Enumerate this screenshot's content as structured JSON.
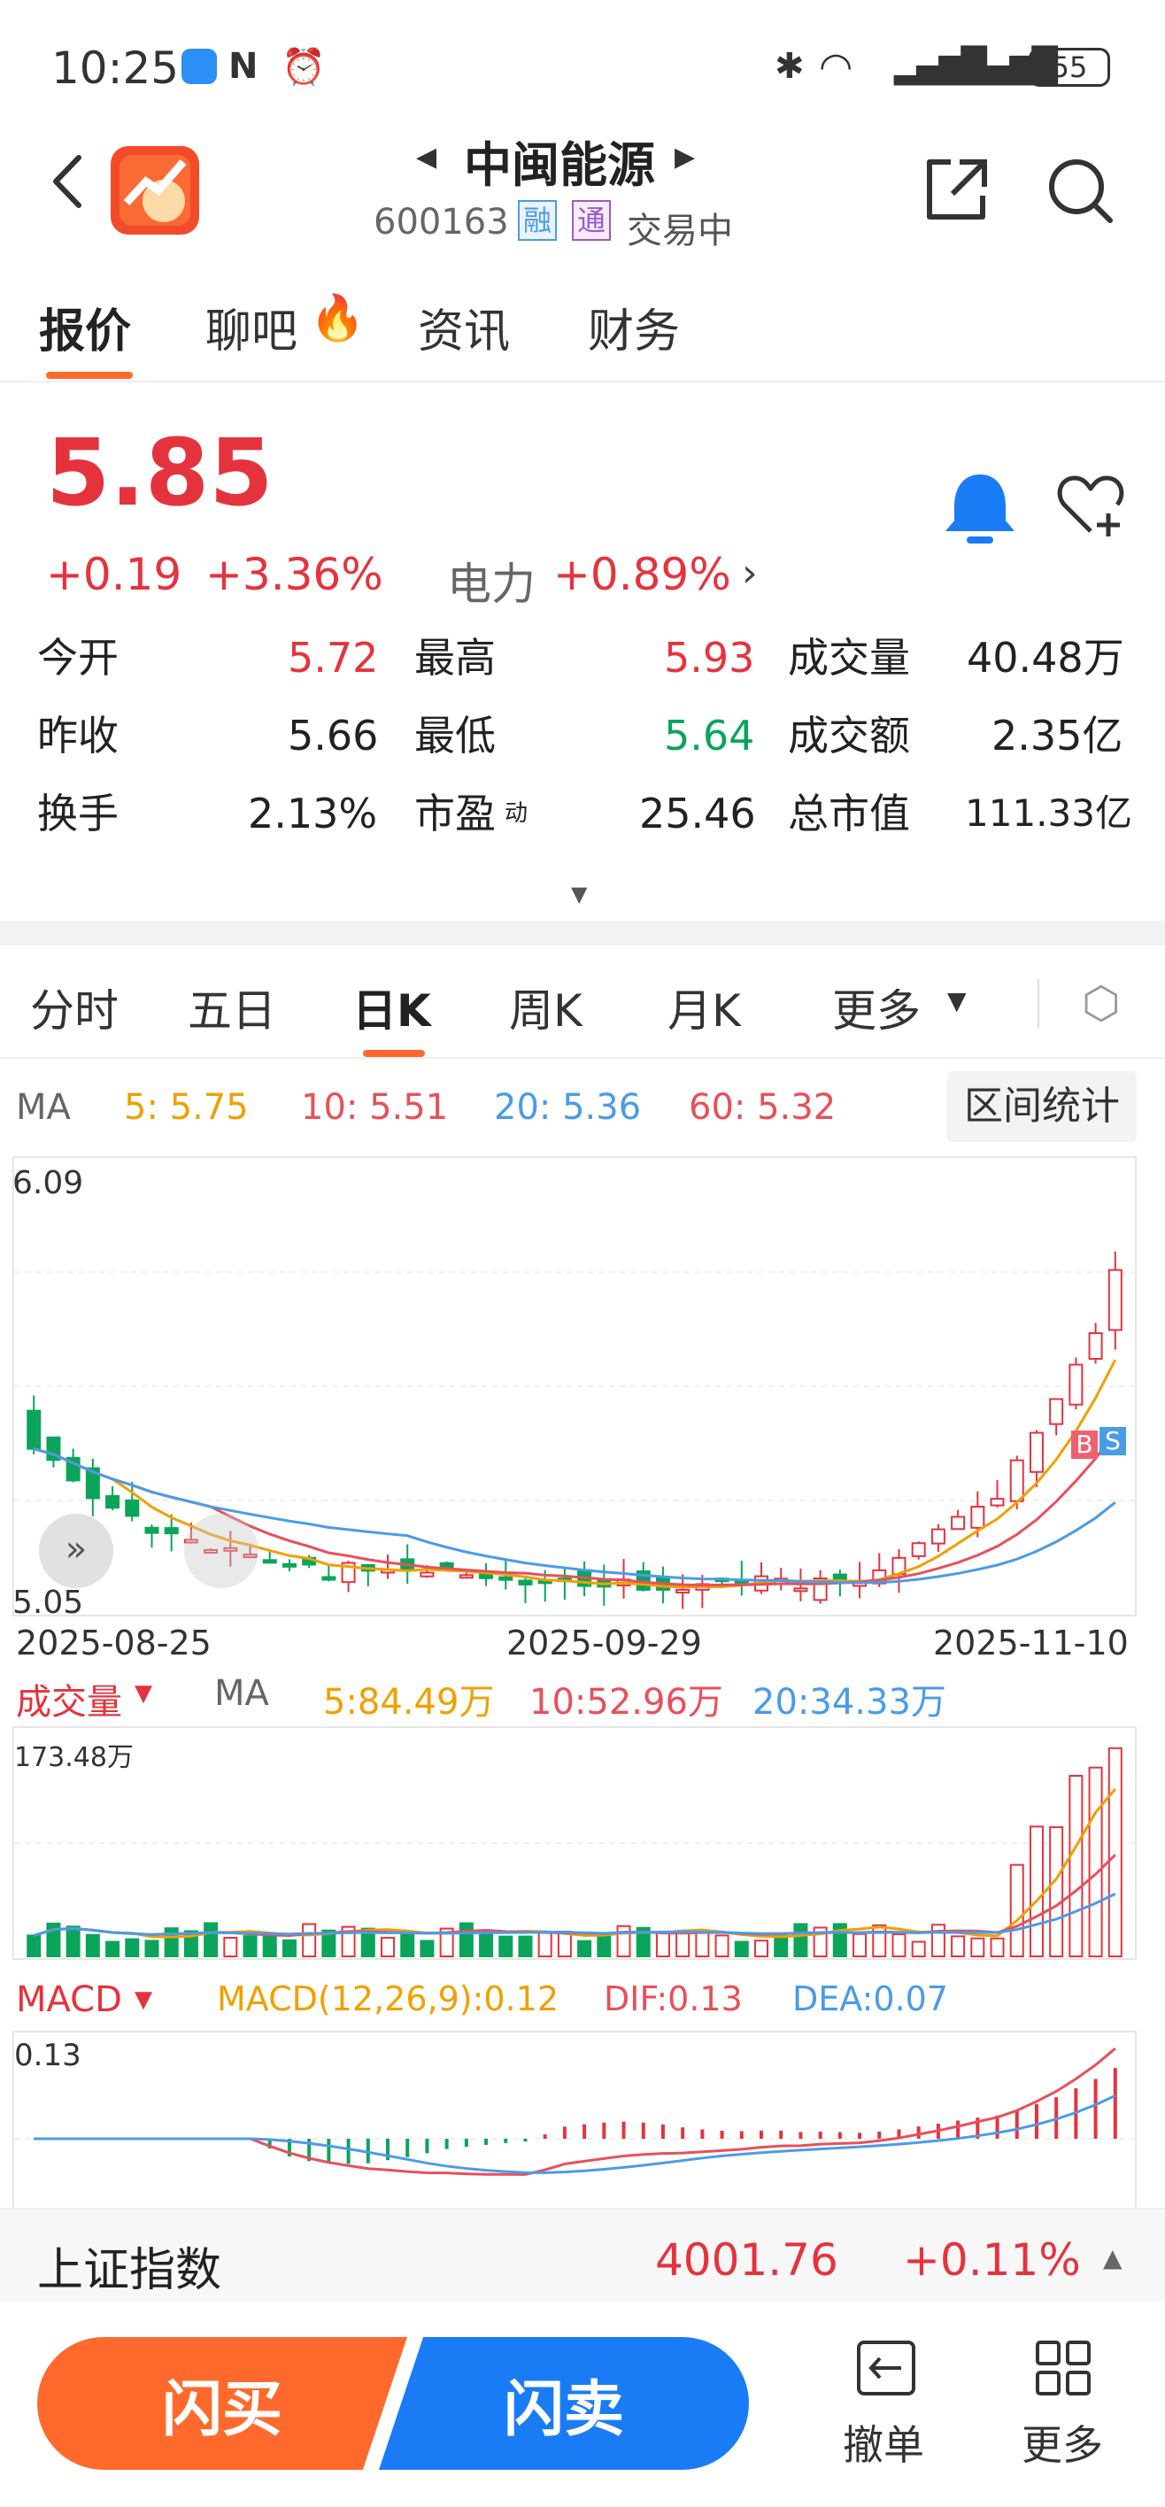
{
  "status_bar": {
    "time": "10:25",
    "battery": "55"
  },
  "header": {
    "title": "中闽能源",
    "code": "600163",
    "badge_rong": "融",
    "badge_tong": "通",
    "trading_status": "交易中"
  },
  "tabs": [
    {
      "label": "报价"
    },
    {
      "label": "聊吧"
    },
    {
      "label": "资讯"
    },
    {
      "label": "财务"
    }
  ],
  "quote": {
    "price": "5.85",
    "change": "+0.19",
    "change_pct": "+3.36%",
    "sector": {
      "name": "电力",
      "change": "+0.89%"
    },
    "rows": [
      [
        {
          "label": "今开",
          "value": "5.72"
        },
        {
          "label": "最高",
          "value": "5.93"
        },
        {
          "label": "成交量",
          "value": "40.48万"
        }
      ],
      [
        {
          "label": "昨收",
          "value": "5.66"
        },
        {
          "label": "最低",
          "value": "5.64"
        },
        {
          "label": "成交额",
          "value": "2.35亿"
        }
      ],
      [
        {
          "label": "换手",
          "value": "2.13%"
        },
        {
          "label": "市盈",
          "sup": "动",
          "value": "25.46"
        },
        {
          "label": "总市值",
          "value": "111.33亿"
        }
      ]
    ]
  },
  "chart_tabs": [
    {
      "label": "分时"
    },
    {
      "label": "五日"
    },
    {
      "label": "日K"
    },
    {
      "label": "周K"
    },
    {
      "label": "月K"
    },
    {
      "label": "更多"
    }
  ],
  "ma_bar": {
    "ma": "MA",
    "ma5": "5:  5.75",
    "ma10": "10:  5.51",
    "ma20": "20:  5.36",
    "ma60": "60:  5.32",
    "range_button": "区间统计"
  },
  "kline": {
    "top_price": "6.09",
    "bottom_price": "5.05",
    "dates": [
      "2025-08-25",
      "2025-09-29",
      "2025-11-10"
    ],
    "buy_mark": "B",
    "sell_mark": "S"
  },
  "volume_bar": {
    "title": "成交量",
    "ma": "MA",
    "ma5": "5:84.49万",
    "ma10": "10:52.96万",
    "ma20": "20:34.33万",
    "max_label": "173.48万"
  },
  "macd_bar": {
    "title": "MACD",
    "params": "MACD(12,26,9):0.12",
    "dif": "DIF:0.13",
    "dea": "DEA:0.07",
    "max_label": "0.13"
  },
  "index_bar": {
    "name": "上证指数",
    "value": "4001.76",
    "change": "+0.11%"
  },
  "bottom": {
    "buy": "闪买",
    "sell": "闪卖",
    "cancel": "撤单",
    "more": "更多"
  },
  "colors": {
    "up": "#e5333d",
    "down": "#0aa55a",
    "accent": "#ff6a2c",
    "buy": "#ff6a2c",
    "sell": "#1a7cf5",
    "ma5": "#f0a000",
    "ma10": "#e8505a",
    "ma20": "#4a9be8"
  }
}
